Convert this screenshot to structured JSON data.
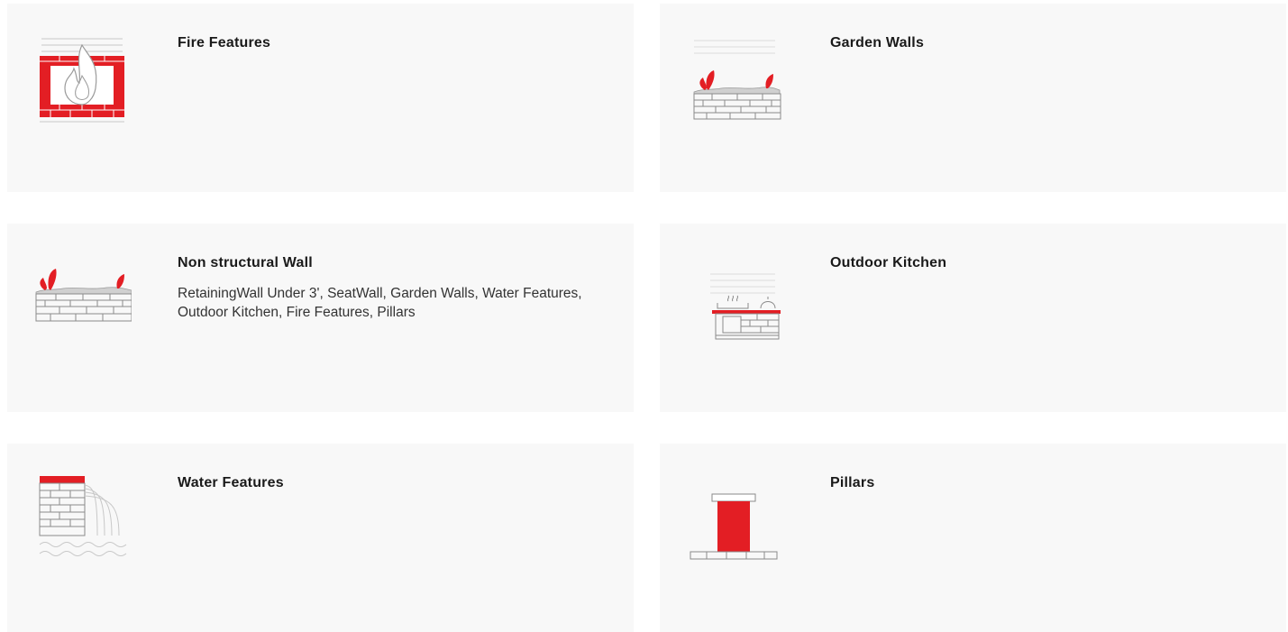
{
  "colors": {
    "accent": "#e31e24",
    "card_bg": "#f8f8f8",
    "line": "#bdbdbd"
  },
  "cards": [
    {
      "title": "Fire Features",
      "icon": "fire-feature-icon"
    },
    {
      "title": "Garden Walls",
      "icon": "garden-wall-icon"
    },
    {
      "title": "Non structural Wall",
      "icon": "non-structural-wall-icon",
      "description": "RetainingWall Under 3', SeatWall, Garden Walls, Water Features, Outdoor Kitchen, Fire Features, Pillars"
    },
    {
      "title": "Outdoor Kitchen",
      "icon": "outdoor-kitchen-icon"
    },
    {
      "title": "Water Features",
      "icon": "water-feature-icon"
    },
    {
      "title": "Pillars",
      "icon": "pillar-icon"
    }
  ]
}
